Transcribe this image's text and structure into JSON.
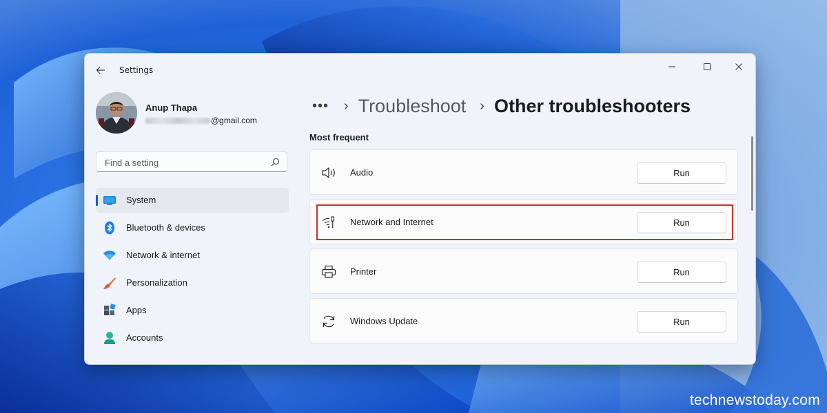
{
  "window": {
    "app_title": "Settings",
    "controls": [
      "minimize-icon",
      "maximize-icon",
      "close-icon"
    ]
  },
  "user": {
    "name": "Anup Thapa",
    "email_visible": "@gmail.com"
  },
  "search": {
    "placeholder": "Find a setting"
  },
  "sidebar": {
    "items": [
      {
        "label": "System",
        "icon": "system-icon",
        "active": true
      },
      {
        "label": "Bluetooth & devices",
        "icon": "bluetooth-icon",
        "active": false
      },
      {
        "label": "Network & internet",
        "icon": "wifi-icon",
        "active": false
      },
      {
        "label": "Personalization",
        "icon": "brush-icon",
        "active": false
      },
      {
        "label": "Apps",
        "icon": "apps-icon",
        "active": false
      },
      {
        "label": "Accounts",
        "icon": "account-icon",
        "active": false
      }
    ]
  },
  "breadcrumb": {
    "overflow": "•••",
    "separator": "›",
    "parent": "Troubleshoot",
    "current": "Other troubleshooters"
  },
  "section": {
    "title": "Most frequent"
  },
  "troubleshooters": [
    {
      "label": "Audio",
      "icon": "speaker-icon",
      "button": "Run",
      "highlighted": false
    },
    {
      "label": "Network and Internet",
      "icon": "network-icon",
      "button": "Run",
      "highlighted": true
    },
    {
      "label": "Printer",
      "icon": "printer-icon",
      "button": "Run",
      "highlighted": false
    },
    {
      "label": "Windows Update",
      "icon": "update-icon",
      "button": "Run",
      "highlighted": false
    }
  ],
  "colors": {
    "accent": "#0a5fcc",
    "highlight_border": "#c8322f",
    "window_bg": "#f0f3f9"
  },
  "watermark": "technewstoday.com"
}
